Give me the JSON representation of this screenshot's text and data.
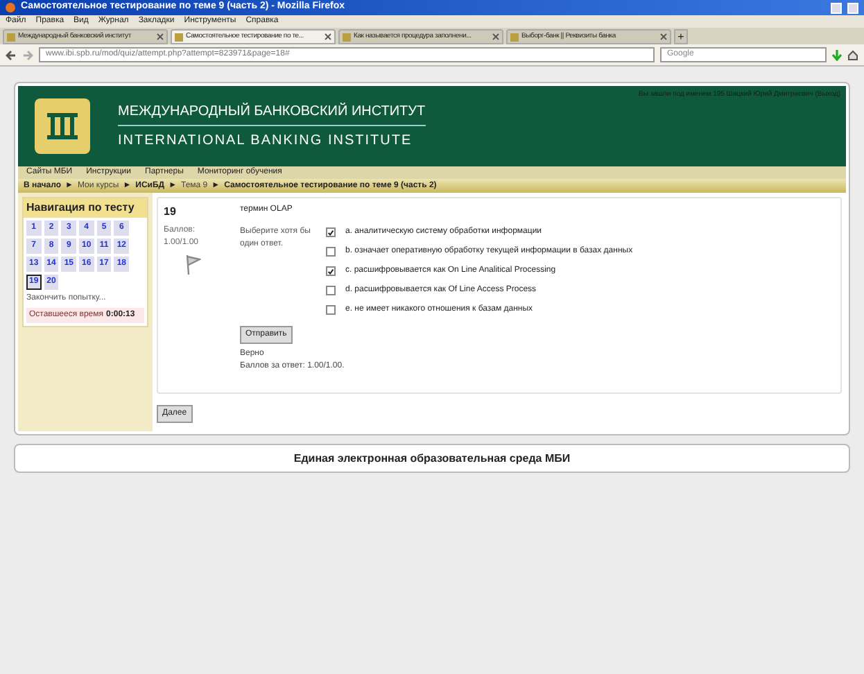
{
  "window": {
    "title": "Самостоятельное тестирование по теме 9 (часть 2) - Mozilla Firefox"
  },
  "menu": [
    "Файл",
    "Правка",
    "Вид",
    "Журнал",
    "Закладки",
    "Инструменты",
    "Справка"
  ],
  "tabs": [
    {
      "label": "Международный банковский институт",
      "selected": false
    },
    {
      "label": "Самостоятельное тестирование по те...",
      "selected": true
    },
    {
      "label": "Как называется процедура заполнени...",
      "selected": false
    },
    {
      "label": "Выборг-банк || Реквизиты банка",
      "selected": false
    }
  ],
  "new_tab": "+",
  "address": {
    "value": "www.ibi.spb.ru/mod/quiz/attempt.php?attempt=823971&page=18#"
  },
  "search": {
    "placeholder": "Google"
  },
  "header": {
    "title_ru": "МЕЖДУНАРОДНЫЙ БАНКОВСКИЙ ИНСТИТУТ",
    "title_en": "INTERNATIONAL BANKING INSTITUTE",
    "user_info": "Вы зашли под именем 195 Шацкий Юрий Дмитриевич (Выход)"
  },
  "site_menu": [
    "Сайты МБИ",
    "Инструкции",
    "Партнеры",
    "Мониторинг обучения"
  ],
  "breadcrumb": [
    "В начало",
    "Мои курсы",
    "ИСиБД",
    "Тема 9",
    "Самостоятельное тестирование по теме 9 (часть 2)"
  ],
  "breadcrumb_sep": "►",
  "quiz_nav": {
    "title": "Навигация по тесту",
    "questions": [
      {
        "label": "1",
        "selected": false
      },
      {
        "label": "2",
        "selected": false
      },
      {
        "label": "3",
        "selected": false
      },
      {
        "label": "4",
        "selected": false
      },
      {
        "label": "5",
        "selected": false
      },
      {
        "label": "6",
        "selected": false
      },
      {
        "label": "7",
        "selected": false
      },
      {
        "label": "8",
        "selected": false
      },
      {
        "label": "9",
        "selected": false
      },
      {
        "label": "10",
        "selected": false
      },
      {
        "label": "11",
        "selected": false
      },
      {
        "label": "12",
        "selected": false
      },
      {
        "label": "13",
        "selected": false
      },
      {
        "label": "14",
        "selected": false
      },
      {
        "label": "15",
        "selected": false
      },
      {
        "label": "16",
        "selected": false
      },
      {
        "label": "17",
        "selected": false
      },
      {
        "label": "18",
        "selected": false
      },
      {
        "label": "19",
        "selected": true
      },
      {
        "label": "20",
        "selected": false
      }
    ],
    "finish": "Закончить попытку...",
    "time_label": "Оставшееся время",
    "time": "0:00:13"
  },
  "question": {
    "number": "19",
    "score_label": "Баллов:",
    "score": "1.00/1.00",
    "text": "термин OLAP",
    "prompt": "Выберите хотя бы один ответ.",
    "answers": [
      {
        "text": "a. аналитическую систему обработки информации",
        "checked": true
      },
      {
        "text": "b. означает оперативную обработку текущей информации в базах данных",
        "checked": false
      },
      {
        "text": "c. расшифровывается как On Line Analitical Processing",
        "checked": true
      },
      {
        "text": "d. расшифровывается как Of Line Access Process",
        "checked": false
      },
      {
        "text": "e. не имеет никакого отношения к базам данных",
        "checked": false
      }
    ],
    "submit": "Отправить",
    "feedback": "Верно",
    "points": "Баллов за ответ: 1.00/1.00."
  },
  "next_button": "Далее",
  "footer": "Единая электронная образовательная среда МБИ"
}
